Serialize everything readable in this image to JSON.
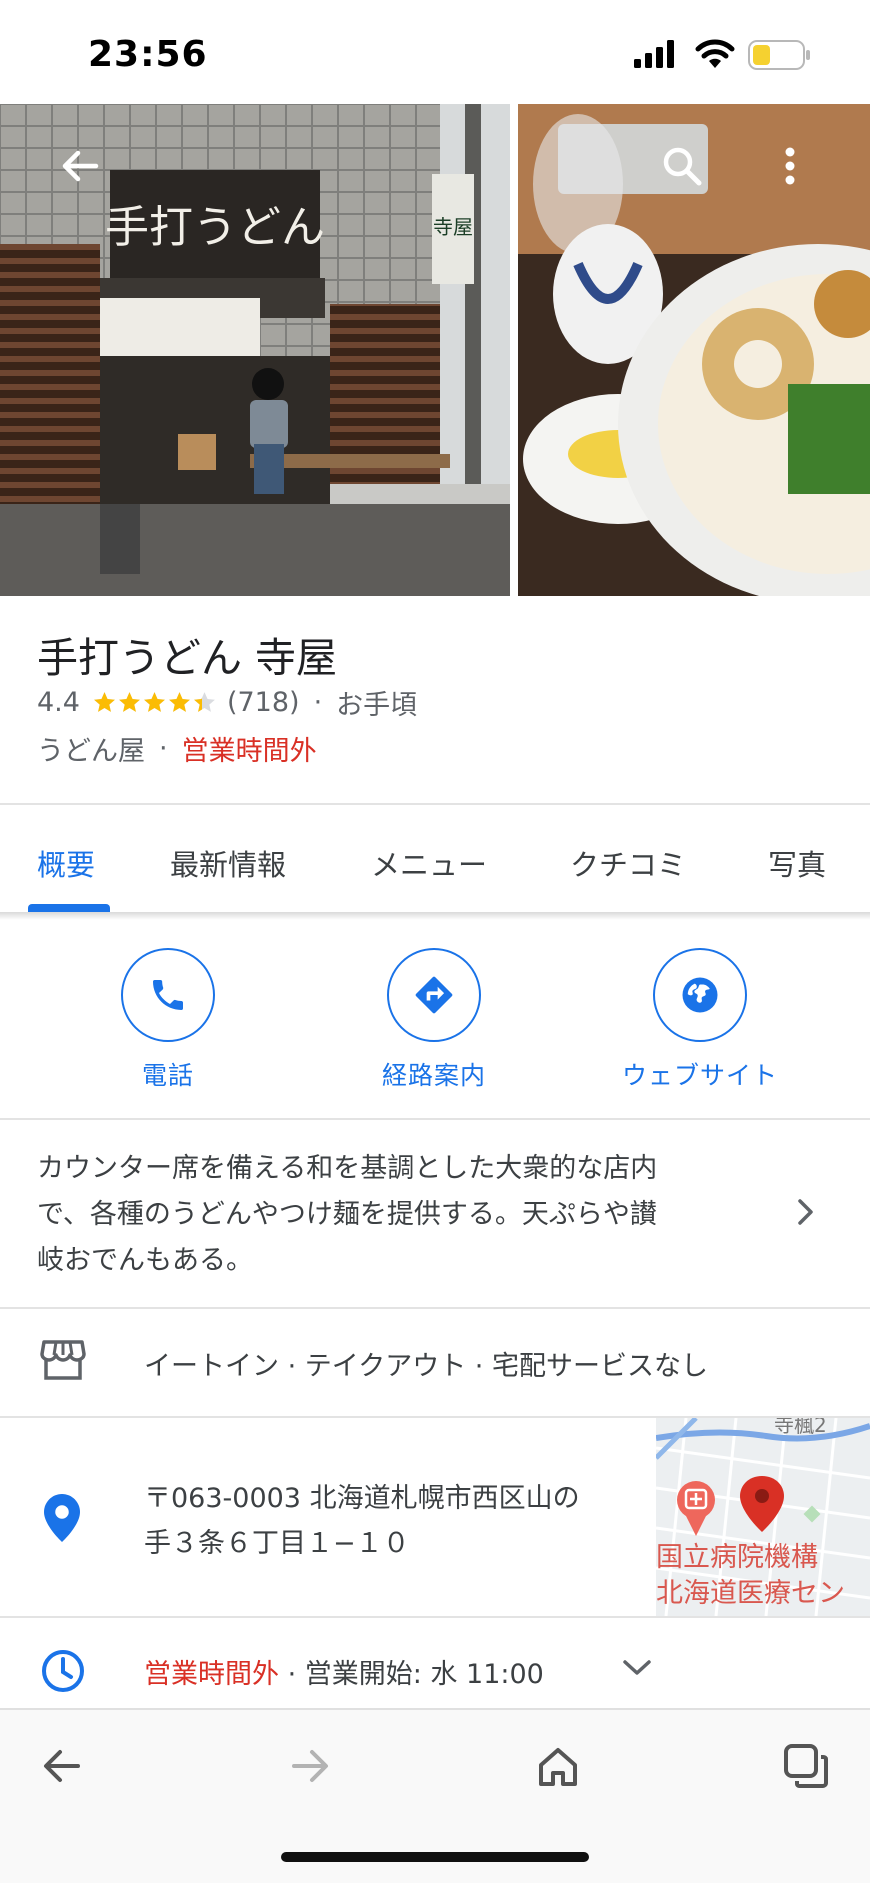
{
  "status_bar": {
    "time": "23:56"
  },
  "hero": {
    "back_icon": "arrow-left-icon",
    "search_icon": "search-icon",
    "more_icon": "more-vert-icon",
    "storefront_sign": "手打うどん",
    "banner_sign": "寺屋"
  },
  "place": {
    "name": "手打うどん 寺屋",
    "rating": "4.4",
    "stars": 4.4,
    "review_count": "(718)",
    "price": "お手頃",
    "category": "うどん屋",
    "status": "営業時間外"
  },
  "tabs": [
    {
      "label": "概要"
    },
    {
      "label": "最新情報"
    },
    {
      "label": "メニュー"
    },
    {
      "label": "クチコミ"
    },
    {
      "label": "写真"
    }
  ],
  "actions": [
    {
      "label": "電話",
      "icon": "phone-icon"
    },
    {
      "label": "経路案内",
      "icon": "directions-icon"
    },
    {
      "label": "ウェブサイト",
      "icon": "globe-icon"
    }
  ],
  "description": {
    "line1": "カウンター席を備える和を基調とした大衆的な店内",
    "line2": "で、各種のうどんやつけ麺を提供する。天ぷらや讃",
    "line3": "岐おでんもある。"
  },
  "service": {
    "text": "イートイン · テイクアウト · 宅配サービスなし"
  },
  "address": {
    "line1": "〒063-0003 北海道札幌市西区山の",
    "line2": "手３条６丁目１−１０",
    "map_label_1": "国立病院機構",
    "map_label_2": "北海道医療セン",
    "map_label_top": "寺楓2"
  },
  "hours": {
    "status": "営業時間外",
    "separator": " · ",
    "opening": "営業開始: 水 11:00"
  },
  "colors": {
    "accent": "#1a73e8",
    "closed": "#d93025",
    "star": "#fbbc04"
  }
}
